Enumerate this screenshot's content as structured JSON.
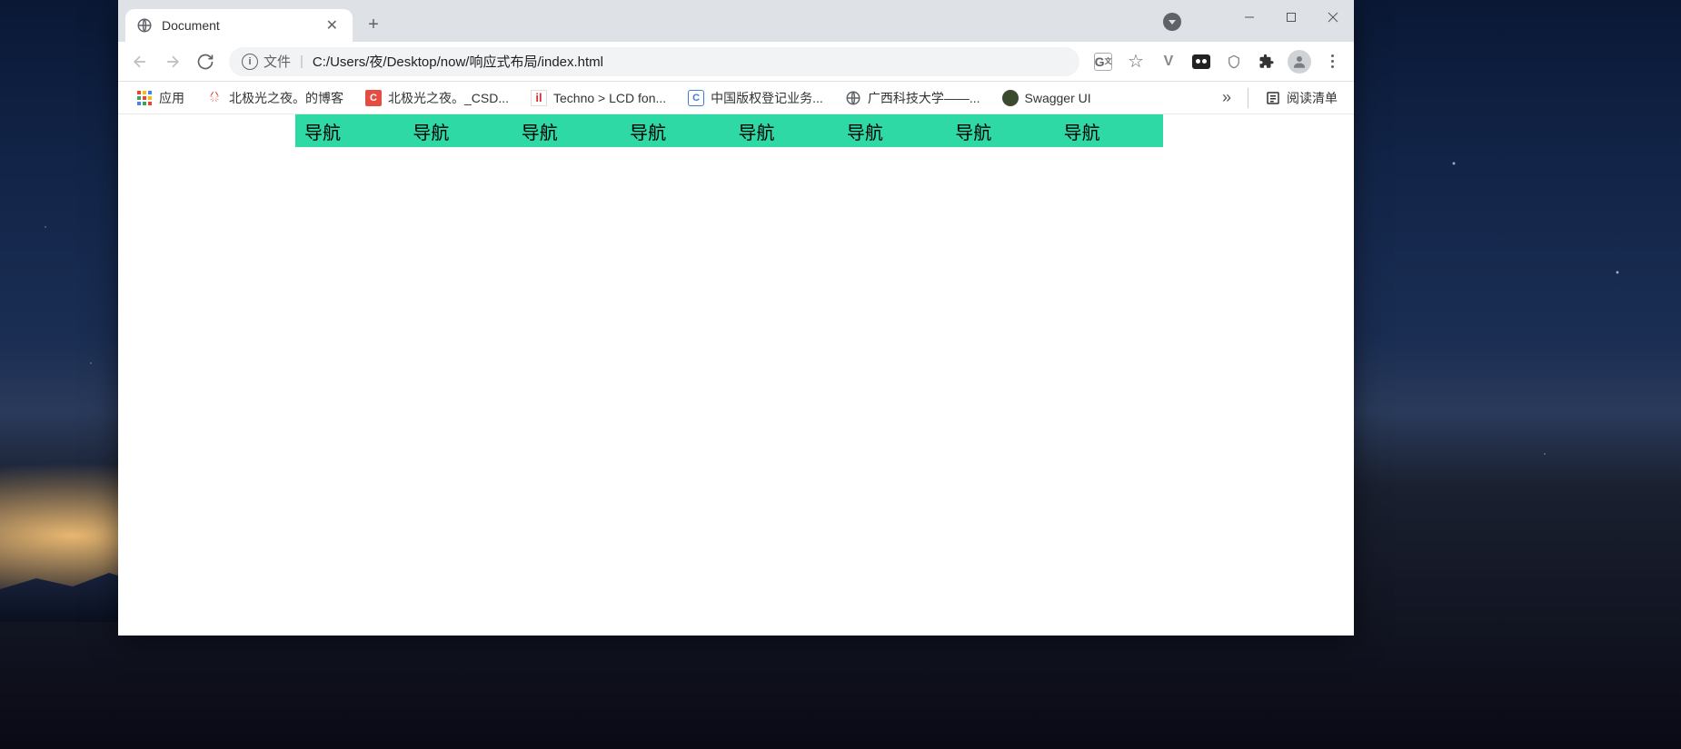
{
  "browser": {
    "tab": {
      "title": "Document"
    },
    "omnibox": {
      "chip_label": "文件",
      "url": "C:/Users/夜/Desktop/now/响应式布局/index.html"
    },
    "bookmarks": {
      "apps_label": "应用",
      "items": [
        {
          "icon": "huawei",
          "label": "北极光之夜。的博客"
        },
        {
          "icon": "csdn",
          "label": "北极光之夜。_CSD..."
        },
        {
          "icon": "red_il",
          "label": "Techno > LCD fon..."
        },
        {
          "icon": "blue_c",
          "label": "中国版权登记业务..."
        },
        {
          "icon": "globe",
          "label": "广西科技大学——..."
        },
        {
          "icon": "swagger",
          "label": "Swagger UI"
        }
      ],
      "overflow": "»",
      "reading_list": "阅读清单"
    }
  },
  "page": {
    "nav_items": [
      "导航",
      "导航",
      "导航",
      "导航",
      "导航",
      "导航",
      "导航",
      "导航"
    ],
    "nav_color": "#2ed9a6"
  }
}
